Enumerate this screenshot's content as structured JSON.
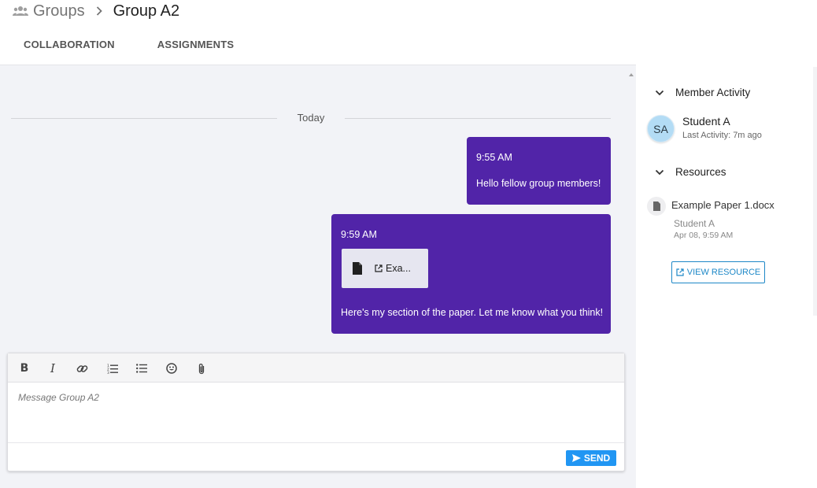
{
  "breadcrumb": {
    "icon": "groups-icon",
    "parent": "Groups",
    "separator_icon": "chevron-right-icon",
    "current": "Group A2"
  },
  "tabs": [
    {
      "label": "COLLABORATION"
    },
    {
      "label": "ASSIGNMENTS"
    }
  ],
  "chat": {
    "date_label": "Today",
    "messages": [
      {
        "time": "9:55 AM",
        "text": "Hello fellow group members!"
      },
      {
        "time": "9:59 AM",
        "attachment": {
          "icon": "document-icon",
          "link_icon": "open-external-icon",
          "name": "Exa..."
        },
        "text": "Here's my section of the paper. Let me know what you think!"
      }
    ],
    "bubble_color": "#5124a8"
  },
  "composer": {
    "toolbar": [
      {
        "name": "bold-button",
        "label": "B"
      },
      {
        "name": "italic-button",
        "label": "I"
      },
      {
        "name": "link-button",
        "icon": "link-icon"
      },
      {
        "name": "ordered-list-button",
        "icon": "ordered-list-icon"
      },
      {
        "name": "bullet-list-button",
        "icon": "bullet-list-icon"
      },
      {
        "name": "emoji-button",
        "icon": "emoji-icon"
      },
      {
        "name": "attach-button",
        "icon": "paperclip-icon"
      }
    ],
    "placeholder": "Message Group A2",
    "send_label": "SEND",
    "send_icon": "send-icon",
    "send_color": "#2196f3"
  },
  "member_activity": {
    "title": "Member Activity",
    "members": [
      {
        "initials": "SA",
        "name": "Student A",
        "last_activity": "Last Activity: 7m ago"
      }
    ]
  },
  "resources": {
    "title": "Resources",
    "items": [
      {
        "icon": "document-icon",
        "name": "Example Paper 1.docx",
        "author": "Student A",
        "date": "Apr 08, 9:59 AM"
      }
    ],
    "view_label": "VIEW RESOURCE",
    "view_icon": "open-external-icon",
    "accent": "#1e88c7"
  }
}
